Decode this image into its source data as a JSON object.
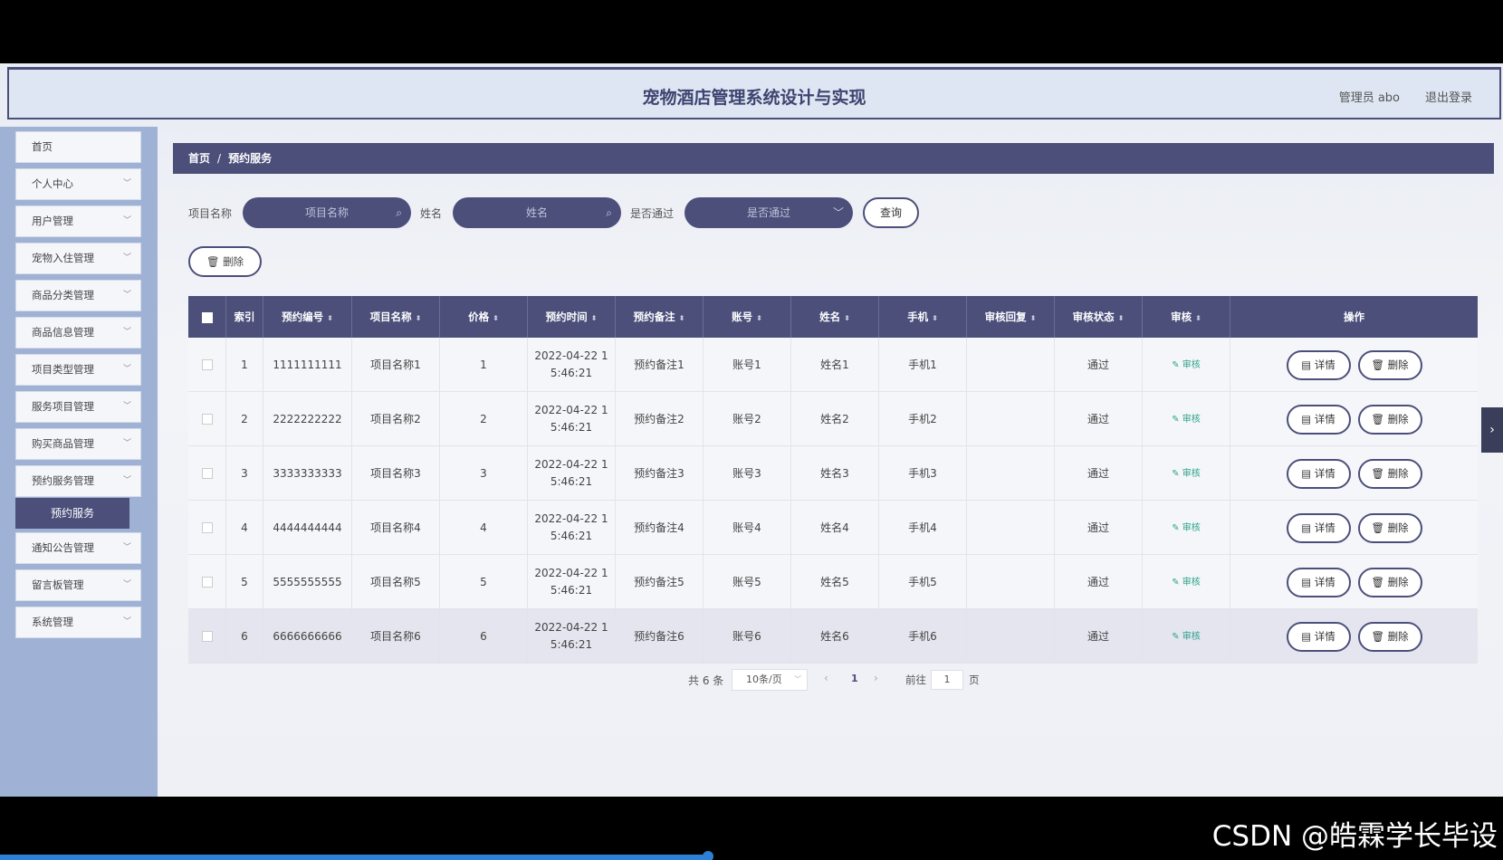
{
  "header": {
    "title": "宠物酒店管理系统设计与实现",
    "user": "管理员 abo",
    "logout": "退出登录"
  },
  "sidebar": {
    "items": [
      {
        "label": "首页"
      },
      {
        "label": "个人中心"
      },
      {
        "label": "用户管理"
      },
      {
        "label": "宠物入住管理"
      },
      {
        "label": "商品分类管理"
      },
      {
        "label": "商品信息管理"
      },
      {
        "label": "项目类型管理"
      },
      {
        "label": "服务项目管理"
      },
      {
        "label": "购买商品管理"
      },
      {
        "label": "预约服务管理"
      },
      {
        "label": "通知公告管理"
      },
      {
        "label": "留言板管理"
      },
      {
        "label": "系统管理"
      }
    ],
    "active_sub": "预约服务"
  },
  "breadcrumb": {
    "home": "首页",
    "sep": "/",
    "current": "预约服务"
  },
  "search": {
    "project_label": "项目名称",
    "project_placeholder": "项目名称",
    "name_label": "姓名",
    "name_placeholder": "姓名",
    "passed_label": "是否通过",
    "passed_placeholder": "是否通过",
    "query_button": "查询"
  },
  "toolbar": {
    "delete_label": "删除"
  },
  "table": {
    "headers": [
      "索引",
      "预约编号",
      "项目名称",
      "价格",
      "预约时间",
      "预约备注",
      "账号",
      "姓名",
      "手机",
      "审核回复",
      "审核状态",
      "审核",
      "操作"
    ],
    "rows": [
      {
        "index": "1",
        "code": "1111111111",
        "project": "项目名称1",
        "price": "1",
        "time1": "2022-04-22 1",
        "time2": "5:46:21",
        "note": "预约备注1",
        "account": "账号1",
        "name": "姓名1",
        "phone": "手机1",
        "reply": "",
        "status": "通过",
        "audit": "审核"
      },
      {
        "index": "2",
        "code": "2222222222",
        "project": "项目名称2",
        "price": "2",
        "time1": "2022-04-22 1",
        "time2": "5:46:21",
        "note": "预约备注2",
        "account": "账号2",
        "name": "姓名2",
        "phone": "手机2",
        "reply": "",
        "status": "通过",
        "audit": "审核"
      },
      {
        "index": "3",
        "code": "3333333333",
        "project": "项目名称3",
        "price": "3",
        "time1": "2022-04-22 1",
        "time2": "5:46:21",
        "note": "预约备注3",
        "account": "账号3",
        "name": "姓名3",
        "phone": "手机3",
        "reply": "",
        "status": "通过",
        "audit": "审核"
      },
      {
        "index": "4",
        "code": "4444444444",
        "project": "项目名称4",
        "price": "4",
        "time1": "2022-04-22 1",
        "time2": "5:46:21",
        "note": "预约备注4",
        "account": "账号4",
        "name": "姓名4",
        "phone": "手机4",
        "reply": "",
        "status": "通过",
        "audit": "审核"
      },
      {
        "index": "5",
        "code": "5555555555",
        "project": "项目名称5",
        "price": "5",
        "time1": "2022-04-22 1",
        "time2": "5:46:21",
        "note": "预约备注5",
        "account": "账号5",
        "name": "姓名5",
        "phone": "手机5",
        "reply": "",
        "status": "通过",
        "audit": "审核"
      },
      {
        "index": "6",
        "code": "6666666666",
        "project": "项目名称6",
        "price": "6",
        "time1": "2022-04-22 1",
        "time2": "5:46:21",
        "note": "预约备注6",
        "account": "账号6",
        "name": "姓名6",
        "phone": "手机6",
        "reply": "",
        "status": "通过",
        "audit": "审核"
      }
    ],
    "detail_label": "详情",
    "delete_label": "删除"
  },
  "pagination": {
    "total": "共 6 条",
    "page_size": "10条/页",
    "current": "1",
    "goto": "前往",
    "goto_value": "1",
    "page_unit": "页"
  },
  "watermark": "CSDN @皓霖学长毕设",
  "colors": {
    "accent": "#4b4f7a",
    "audit": "#2aa38c",
    "sidebar": "#9fb1d4"
  },
  "icons": {
    "search": "search-icon",
    "trash": "trash-icon",
    "doc": "document-icon",
    "edit": "edit-icon",
    "chevron": "chevron-down-icon"
  }
}
